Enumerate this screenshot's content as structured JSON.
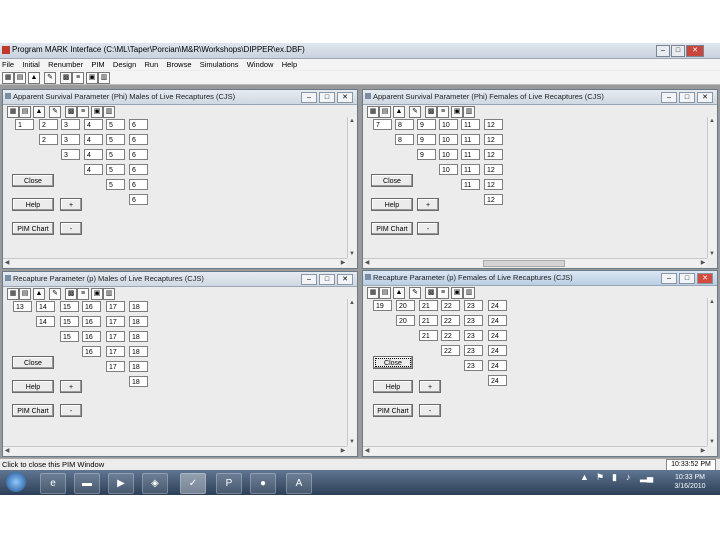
{
  "app": {
    "title": "Program MARK Interface  (C:\\ML\\Taper\\Porcian\\M&R\\Workshops\\DIPPER\\ex.DBF)",
    "menu": [
      "File",
      "Initial",
      "Renumber",
      "PIM",
      "Design",
      "Run",
      "Browse",
      "Simulations",
      "Window",
      "Help"
    ]
  },
  "windows": {
    "phi_males": {
      "title": "Apparent Survival Parameter (Phi) Males of Live Recaptures (CJS)",
      "rows": [
        [
          "1",
          "2",
          "3",
          "4",
          "5",
          "6"
        ],
        [
          "2",
          "3",
          "4",
          "5",
          "6"
        ],
        [
          "3",
          "4",
          "5",
          "6"
        ],
        [
          "4",
          "5",
          "6"
        ],
        [
          "5",
          "6"
        ],
        [
          "6"
        ]
      ],
      "close": "Close",
      "help": "Help",
      "plus": "+",
      "pim_chart": "PIM Chart",
      "minus": "-"
    },
    "phi_females": {
      "title": "Apparent Survival Parameter (Phi) Females of Live Recaptures (CJS)",
      "rows": [
        [
          "7",
          "8",
          "9",
          "10",
          "11",
          "12"
        ],
        [
          "8",
          "9",
          "10",
          "11",
          "12"
        ],
        [
          "9",
          "10",
          "11",
          "12"
        ],
        [
          "10",
          "11",
          "12"
        ],
        [
          "11",
          "12"
        ],
        [
          "12"
        ]
      ],
      "close": "Close",
      "help": "Help",
      "plus": "+",
      "pim_chart": "PIM Chart",
      "minus": "-"
    },
    "p_males": {
      "title": "Recapture Parameter (p) Males of Live Recaptures (CJS)",
      "rows": [
        [
          "13",
          "14",
          "15",
          "16",
          "17",
          "18"
        ],
        [
          "14",
          "15",
          "16",
          "17",
          "18"
        ],
        [
          "15",
          "16",
          "17",
          "18"
        ],
        [
          "16",
          "17",
          "18"
        ],
        [
          "17",
          "18"
        ],
        [
          "18"
        ]
      ],
      "close": "Close",
      "help": "Help",
      "plus": "+",
      "pim_chart": "PIM Chart",
      "minus": "-"
    },
    "p_females": {
      "title": "Recapture Parameter (p) Females of Live Recaptures (CJS)",
      "rows": [
        [
          "19",
          "20",
          "21",
          "22",
          "23",
          "24"
        ],
        [
          "20",
          "21",
          "22",
          "23",
          "24"
        ],
        [
          "21",
          "22",
          "23",
          "24"
        ],
        [
          "22",
          "23",
          "24"
        ],
        [
          "23",
          "24"
        ],
        [
          "24"
        ]
      ],
      "close": "Close",
      "help": "Help",
      "plus": "+",
      "pim_chart": "PIM Chart",
      "minus": "-"
    }
  },
  "status": {
    "message": "Click to close this PIM Window",
    "time": "10:33:52 PM"
  },
  "taskbar": {
    "clock_time": "10:33 PM",
    "clock_date": "3/16/2010"
  }
}
